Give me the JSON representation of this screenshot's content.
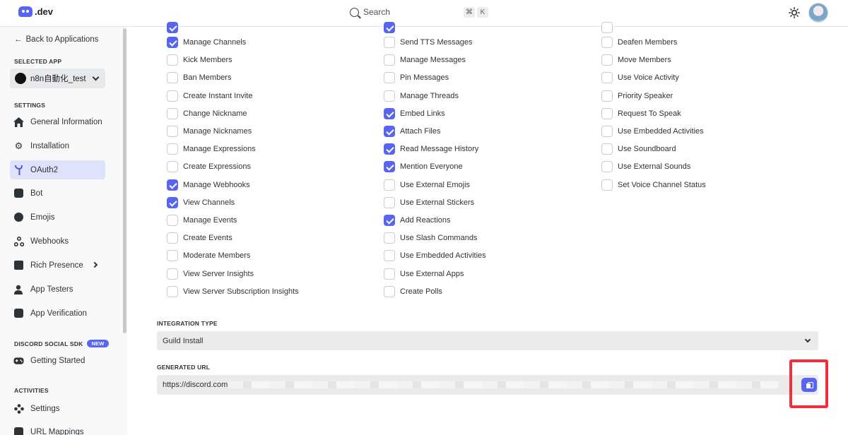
{
  "topbar": {
    "logo_text": ".dev",
    "search_label": "Search",
    "shortcut_keys": [
      "⌘",
      "K"
    ],
    "icons": [
      "discord-logo-icon",
      "search-icon",
      "sun-icon",
      "avatar"
    ]
  },
  "sidebar": {
    "back_label": "Back to Applications",
    "selected_app_label": "SELECTED APP",
    "selected_app": "n8n自動化_test",
    "settings_label": "SETTINGS",
    "settings_items": [
      {
        "label": "General Information",
        "icon": "home-icon"
      },
      {
        "label": "Installation",
        "icon": "gear-icon"
      },
      {
        "label": "OAuth2",
        "icon": "wrench-icon",
        "active": true
      },
      {
        "label": "Bot",
        "icon": "bot-icon"
      },
      {
        "label": "Emojis",
        "icon": "emoji-icon"
      },
      {
        "label": "Webhooks",
        "icon": "webhook-icon"
      },
      {
        "label": "Rich Presence",
        "icon": "presence-icon",
        "has_submenu": true
      },
      {
        "label": "App Testers",
        "icon": "user-icon"
      },
      {
        "label": "App Verification",
        "icon": "verify-icon"
      }
    ],
    "social_sdk_label": "DISCORD SOCIAL SDK",
    "social_sdk_badge": "NEW",
    "social_sdk_items": [
      {
        "label": "Getting Started",
        "icon": "gamepad-icon"
      }
    ],
    "activities_label": "ACTIVITIES",
    "activities_items": [
      {
        "label": "Settings",
        "icon": "activity-settings-icon"
      },
      {
        "label": "URL Mappings",
        "icon": "link-icon"
      }
    ]
  },
  "permissions": {
    "column1": [
      {
        "label": "Manage Channels",
        "checked": true
      },
      {
        "label": "Kick Members",
        "checked": false
      },
      {
        "label": "Ban Members",
        "checked": false
      },
      {
        "label": "Create Instant Invite",
        "checked": false
      },
      {
        "label": "Change Nickname",
        "checked": false
      },
      {
        "label": "Manage Nicknames",
        "checked": false
      },
      {
        "label": "Manage Expressions",
        "checked": false
      },
      {
        "label": "Create Expressions",
        "checked": false
      },
      {
        "label": "Manage Webhooks",
        "checked": true
      },
      {
        "label": "View Channels",
        "checked": true
      },
      {
        "label": "Manage Events",
        "checked": false
      },
      {
        "label": "Create Events",
        "checked": false
      },
      {
        "label": "Moderate Members",
        "checked": false
      },
      {
        "label": "View Server Insights",
        "checked": false
      },
      {
        "label": "View Server Subscription Insights",
        "checked": false
      }
    ],
    "column2": [
      {
        "label": "Send TTS Messages",
        "checked": false
      },
      {
        "label": "Manage Messages",
        "checked": false
      },
      {
        "label": "Pin Messages",
        "checked": false
      },
      {
        "label": "Manage Threads",
        "checked": false
      },
      {
        "label": "Embed Links",
        "checked": true
      },
      {
        "label": "Attach Files",
        "checked": true
      },
      {
        "label": "Read Message History",
        "checked": true
      },
      {
        "label": "Mention Everyone",
        "checked": true
      },
      {
        "label": "Use External Emojis",
        "checked": false
      },
      {
        "label": "Use External Stickers",
        "checked": false
      },
      {
        "label": "Add Reactions",
        "checked": true
      },
      {
        "label": "Use Slash Commands",
        "checked": false
      },
      {
        "label": "Use Embedded Activities",
        "checked": false
      },
      {
        "label": "Use External Apps",
        "checked": false
      },
      {
        "label": "Create Polls",
        "checked": false
      }
    ],
    "column3": [
      {
        "label": "Deafen Members",
        "checked": false
      },
      {
        "label": "Move Members",
        "checked": false
      },
      {
        "label": "Use Voice Activity",
        "checked": false
      },
      {
        "label": "Priority Speaker",
        "checked": false
      },
      {
        "label": "Request To Speak",
        "checked": false
      },
      {
        "label": "Use Embedded Activities",
        "checked": false
      },
      {
        "label": "Use Soundboard",
        "checked": false
      },
      {
        "label": "Use External Sounds",
        "checked": false
      },
      {
        "label": "Set Voice Channel Status",
        "checked": false
      }
    ]
  },
  "integration": {
    "label": "INTEGRATION TYPE",
    "value": "Guild Install"
  },
  "generated_url": {
    "label": "GENERATED URL",
    "value": "https://discord.com"
  },
  "colors": {
    "accent": "#5865f2",
    "highlight": "#ef2f3e",
    "active_nav_bg": "#dfe2fb"
  }
}
